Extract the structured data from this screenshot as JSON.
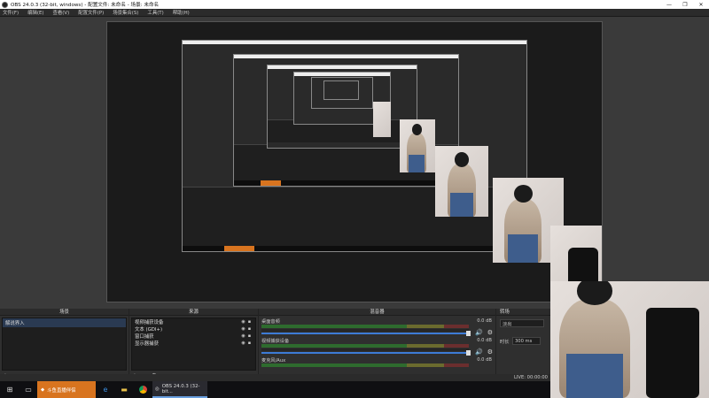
{
  "window": {
    "title": "OBS 24.0.3 (32-bit, windows) - 配置文件: 未命名 - 场景: 未命名",
    "minimize": "—",
    "maximize": "❐",
    "close": "✕"
  },
  "menu": [
    "文件(F)",
    "编辑(E)",
    "查看(V)",
    "配置文件(P)",
    "场景集合(S)",
    "工具(T)",
    "帮助(H)"
  ],
  "docks": {
    "scenes": {
      "title": "场景",
      "items": [
        "解说界入"
      ]
    },
    "sources": {
      "title": "来源",
      "items": [
        "视频捕获设备",
        "文本 (GDI+)",
        "窗口捕获",
        "显示器捕获"
      ]
    },
    "mixer": {
      "title": "混音器",
      "channels": [
        {
          "name": "桌面音频",
          "db": "0.0 dB"
        },
        {
          "name": "视频捕获设备",
          "db": "0.0 dB"
        },
        {
          "name": "麦克风/Aux",
          "db": "0.0 dB"
        }
      ]
    },
    "transitions": {
      "title": "转场",
      "selected": "淡出",
      "duration_label": "时长",
      "duration_value": "300 ms"
    }
  },
  "statusbar": {
    "time": "LIVE: 00:00:00"
  },
  "taskbar": {
    "app_label": "斗鱼直播伴侣",
    "obs_label": "OBS 24.0.3 (32-bit..."
  }
}
